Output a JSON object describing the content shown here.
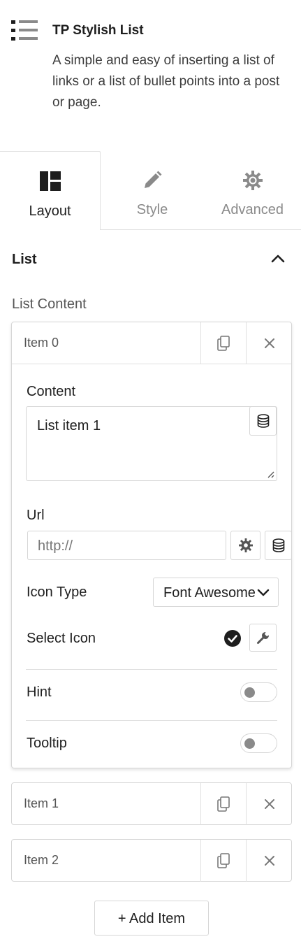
{
  "widget": {
    "title": "TP Stylish List",
    "description": "A simple and easy of inserting a list of links or a list of bullet points into a post or page.",
    "icon": "list-icon"
  },
  "tabs": [
    {
      "label": "Layout",
      "icon": "layout-icon",
      "active": true
    },
    {
      "label": "Style",
      "icon": "pencil-icon",
      "active": false
    },
    {
      "label": "Advanced",
      "icon": "gear-icon",
      "active": false
    }
  ],
  "section": {
    "title": "List",
    "expanded": true
  },
  "list_content_label": "List Content",
  "items": [
    {
      "label": "Item 0",
      "expanded": true,
      "content_label": "Content",
      "content_value": "List item 1",
      "url_label": "Url",
      "url_placeholder": "http://",
      "icon_type_label": "Icon Type",
      "icon_type_value": "Font Awesome",
      "select_icon_label": "Select Icon",
      "selected_icon": "check-circle-icon",
      "hint_label": "Hint",
      "hint_enabled": false,
      "tooltip_label": "Tooltip",
      "tooltip_enabled": false
    },
    {
      "label": "Item 1",
      "expanded": false
    },
    {
      "label": "Item 2",
      "expanded": false
    }
  ],
  "add_item_label": "+ Add Item",
  "colors": {
    "text": "#1e1e1e",
    "muted": "#8a8a8a",
    "border": "#d6d6d6"
  }
}
